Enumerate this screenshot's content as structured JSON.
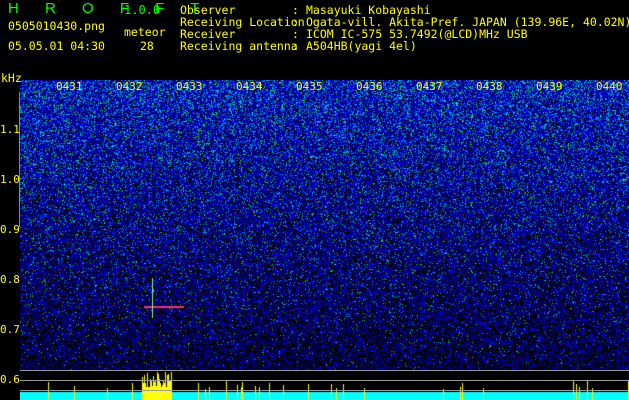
{
  "header": {
    "app_title": "H R O F F T",
    "version": "1.0.0",
    "filename": "0505010430.png",
    "meteor_label": "meteor",
    "datetime": "05.05.01 04:30",
    "meteor_count": "28"
  },
  "info": [
    {
      "key": "Observer",
      "value": "Masayuki Kobayashi"
    },
    {
      "key": "Receiving Location",
      "value": "Ogata-vill. Akita-Pref. JAPAN (139.96E, 40.02N)"
    },
    {
      "key": "Receiver",
      "value": "ICOM IC-575 53.7492(@LCD)MHz USB"
    },
    {
      "key": "Receiving antenna",
      "value": "A504HB(yagi 4el)"
    }
  ],
  "separator": ":",
  "axis": {
    "unit": "kHz",
    "freq_ticks": [
      "1.1",
      "1.0",
      "0.9",
      "0.8",
      "0.7",
      "0.6"
    ],
    "time_labels": [
      "0431",
      "0432",
      "0433",
      "0434",
      "0435",
      "0436",
      "0437",
      "0438",
      "0439",
      "0440"
    ]
  },
  "colors": {
    "text": "#ffff00",
    "title": "#00ff00",
    "noise": "#0000c0",
    "level": "#00ffff",
    "spike": "#ffff00"
  }
}
